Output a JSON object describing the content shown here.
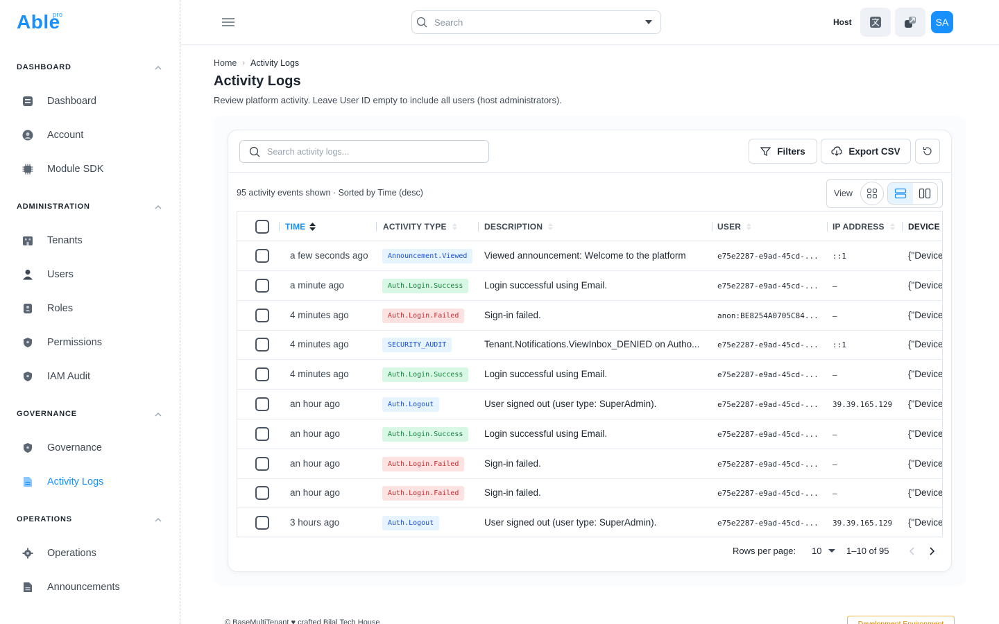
{
  "brand": {
    "name": "Able",
    "tag": "pro"
  },
  "header": {
    "search_placeholder": "Search",
    "host_label": "Host",
    "avatar_initials": "SA"
  },
  "sidebar": {
    "groups": [
      {
        "title": "DASHBOARD",
        "items": [
          {
            "label": "Dashboard"
          },
          {
            "label": "Account"
          },
          {
            "label": "Module SDK"
          }
        ]
      },
      {
        "title": "ADMINISTRATION",
        "items": [
          {
            "label": "Tenants"
          },
          {
            "label": "Users"
          },
          {
            "label": "Roles"
          },
          {
            "label": "Permissions"
          },
          {
            "label": "IAM Audit"
          }
        ]
      },
      {
        "title": "GOVERNANCE",
        "items": [
          {
            "label": "Governance"
          },
          {
            "label": "Activity Logs"
          }
        ]
      },
      {
        "title": "OPERATIONS",
        "items": [
          {
            "label": "Operations"
          },
          {
            "label": "Announcements"
          }
        ]
      }
    ]
  },
  "breadcrumb": {
    "home": "Home",
    "current": "Activity Logs"
  },
  "page": {
    "title": "Activity Logs",
    "subtitle": "Review platform activity. Leave User ID empty to include all users (host administrators)."
  },
  "toolbar": {
    "search_placeholder": "Search activity logs...",
    "filters_label": "Filters",
    "export_label": "Export CSV"
  },
  "summary": "95 activity events shown · Sorted by Time (desc)",
  "view_label": "View",
  "table": {
    "columns": [
      "TIME",
      "ACTIVITY TYPE",
      "DESCRIPTION",
      "USER",
      "IP ADDRESS",
      "DEVICE"
    ],
    "rows": [
      {
        "time": "a few seconds ago",
        "type": "Announcement.Viewed",
        "desc": "Viewed announcement: Welcome to the platform",
        "user": "e75e2287-e9ad-45cd-...",
        "ip": "::1",
        "device": "{\"Device"
      },
      {
        "time": "a minute ago",
        "type": "Auth.Login.Success",
        "desc": "Login successful using Email.",
        "user": "e75e2287-e9ad-45cd-...",
        "ip": "—",
        "device": "{\"Device"
      },
      {
        "time": "4 minutes ago",
        "type": "Auth.Login.Failed",
        "desc": "Sign-in failed.",
        "user": "anon:BE8254A0705C84...",
        "ip": "—",
        "device": "{\"Device"
      },
      {
        "time": "4 minutes ago",
        "type": "SECURITY_AUDIT",
        "desc": "Tenant.Notifications.ViewInbox_DENIED on Autho...",
        "user": "e75e2287-e9ad-45cd-...",
        "ip": "::1",
        "device": "{\"Device"
      },
      {
        "time": "4 minutes ago",
        "type": "Auth.Login.Success",
        "desc": "Login successful using Email.",
        "user": "e75e2287-e9ad-45cd-...",
        "ip": "—",
        "device": "{\"Device"
      },
      {
        "time": "an hour ago",
        "type": "Auth.Logout",
        "desc": "User signed out (user type: SuperAdmin).",
        "user": "e75e2287-e9ad-45cd-...",
        "ip": "39.39.165.129",
        "device": "{\"Device"
      },
      {
        "time": "an hour ago",
        "type": "Auth.Login.Success",
        "desc": "Login successful using Email.",
        "user": "e75e2287-e9ad-45cd-...",
        "ip": "—",
        "device": "{\"Device"
      },
      {
        "time": "an hour ago",
        "type": "Auth.Login.Failed",
        "desc": "Sign-in failed.",
        "user": "e75e2287-e9ad-45cd-...",
        "ip": "—",
        "device": "{\"Device"
      },
      {
        "time": "an hour ago",
        "type": "Auth.Login.Failed",
        "desc": "Sign-in failed.",
        "user": "e75e2287-e9ad-45cd-...",
        "ip": "—",
        "device": "{\"Device"
      },
      {
        "time": "3 hours ago",
        "type": "Auth.Logout",
        "desc": "User signed out (user type: SuperAdmin).",
        "user": "e75e2287-e9ad-45cd-...",
        "ip": "39.39.165.129",
        "device": "{\"Device"
      }
    ]
  },
  "pagination": {
    "rows_label": "Rows per page:",
    "rows_value": "10",
    "range": "1–10 of 95"
  },
  "footer": {
    "left": "© BaseMultiTenant ♥ crafted Bilal Tech House",
    "env": "Development Environment"
  },
  "colors": {
    "accent": "#1890ff",
    "badge_info_bg": "#e6f4ff",
    "badge_info_fg": "#1d4ed8",
    "badge_success_bg": "#d9f7e5",
    "badge_success_fg": "#15803d",
    "badge_danger_bg": "#fde2e2",
    "badge_danger_fg": "#c53030"
  }
}
